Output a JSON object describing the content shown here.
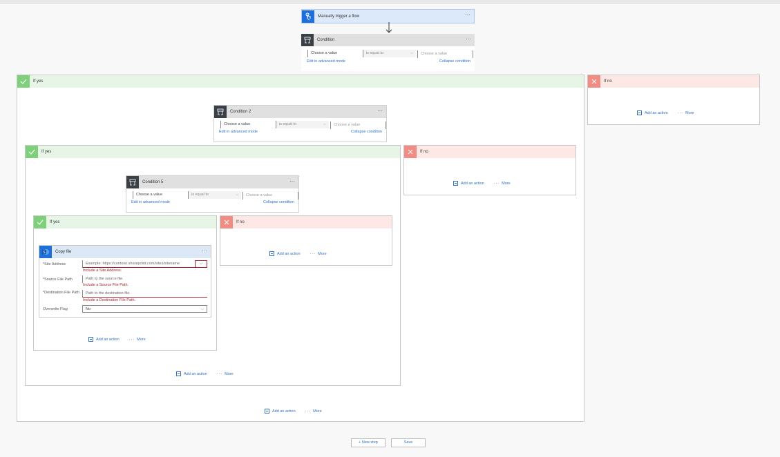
{
  "trigger": {
    "title": "Manually trigger a flow"
  },
  "menu_dots": "···",
  "condition_common": {
    "choose_value": "Choose a value",
    "operator": "is equal to",
    "choose_value_placeholder": "Choose a value",
    "edit_advanced": "Edit in advanced mode",
    "collapse": "Collapse condition"
  },
  "conditions": {
    "c1": {
      "title": "Condition"
    },
    "c2": {
      "title": "Condition 2"
    },
    "c5": {
      "title": "Condition 5"
    }
  },
  "branches": {
    "if_yes": "If yes",
    "if_no": "If no"
  },
  "add_action": {
    "label": "Add an action",
    "more": "More"
  },
  "copy_file": {
    "title": "Copy file",
    "site_address_label": "*Site Address",
    "site_address_placeholder": "Example: https://contoso.sharepoint.com/sites/sitename",
    "site_address_error": "Include a Site Address.",
    "source_path_label": "*Source File Path",
    "source_path_placeholder": "Path to the source file.",
    "source_path_error": "Include a Source File Path.",
    "dest_path_label": "*Destination File Path",
    "dest_path_placeholder": "Path to the destination file.",
    "dest_path_error": "Include a Destination File Path.",
    "overwrite_label": "Overwrite Flag",
    "overwrite_value": "No"
  },
  "footer": {
    "new_step": "+ New step",
    "save": "Save"
  },
  "icons": {
    "trigger": "touch-hand-icon",
    "condition": "condition-icon",
    "yes": "checkmark-icon",
    "no": "close-icon",
    "sharepoint": "sharepoint-icon",
    "add_action": "add-action-icon"
  },
  "colors": {
    "accent": "#2e6fc4",
    "yes_bg": "#e7f5e6",
    "no_bg": "#fde8e6",
    "error": "#a4262c"
  }
}
